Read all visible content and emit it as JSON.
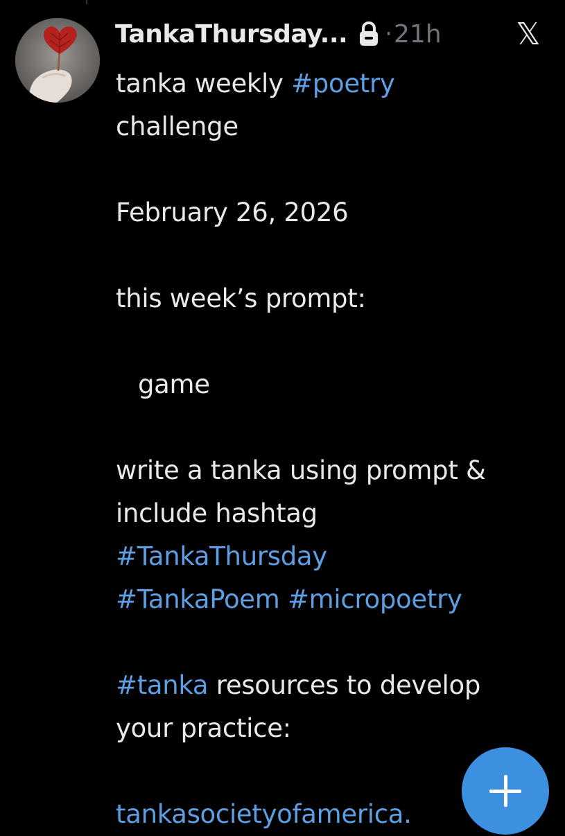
{
  "post": {
    "display_name": "TankaThursday...",
    "separator": "·",
    "timestamp": "21h",
    "platform_logo": "𝕏",
    "icons": {
      "avatar": "avatar-heart-leaf",
      "verified_lock": "lock-icon",
      "platform": "x-logo-icon"
    },
    "text": {
      "line1_prefix": "tanka weekly ",
      "line1_hashtag": "#poetry",
      "line2": "challenge",
      "date": "February 26, 2026",
      "prompt_label": "this week’s prompt:",
      "prompt_word": "game",
      "instruction_line1": "write a tanka using prompt &",
      "instruction_line2": "include hashtag",
      "hashtag_tankathursday": "#TankaThursday",
      "hashtag_tankapoem": "#TankaPoem",
      "hashtag_micropoetry": "#micropoetry",
      "resources_hashtag": "#tanka",
      "resources_line1_rest": " resources to develop",
      "resources_line2": "your practice:",
      "link": "tankasocietyofamerica."
    }
  },
  "compose_button": {
    "label": "+",
    "icon": "plus-icon"
  },
  "colors": {
    "background": "#000000",
    "text": "#e7e9ea",
    "secondary_text": "#71767b",
    "link": "#5e9fe3",
    "fab": "#3d8fe0"
  }
}
